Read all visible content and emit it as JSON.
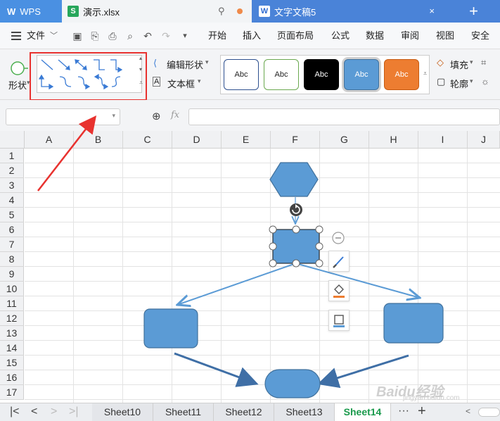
{
  "titlebar": {
    "app_tab": "WPS",
    "file_tab": "演示.xlsx",
    "doc_tab": "文字文稿5",
    "new_tab": "+",
    "close": "×"
  },
  "menubar": {
    "file_menu": "文件",
    "tabs": [
      "开始",
      "插入",
      "页面布局",
      "公式",
      "数据",
      "审阅",
      "视图",
      "安全"
    ]
  },
  "ribbon": {
    "shape_label": "形状",
    "edit_shape": "编辑形状",
    "text_box": "文本框",
    "styles": [
      "Abc",
      "Abc",
      "Abc",
      "Abc",
      "Abc"
    ],
    "fill": "填充",
    "outline": "轮廓"
  },
  "formulabar": {
    "fx": "fx",
    "name_value": "",
    "formula_value": ""
  },
  "grid": {
    "columns": [
      "A",
      "B",
      "C",
      "D",
      "E",
      "F",
      "G",
      "H",
      "I",
      "J"
    ],
    "rows": [
      "1",
      "2",
      "3",
      "4",
      "5",
      "6",
      "7",
      "8",
      "9",
      "10",
      "11",
      "12",
      "13",
      "14",
      "15",
      "16",
      "17"
    ]
  },
  "sheets": {
    "tabs": [
      "Sheet10",
      "Sheet11",
      "Sheet12",
      "Sheet13",
      "Sheet14"
    ],
    "active": "Sheet14",
    "more": "···",
    "add": "+"
  },
  "colors": {
    "shape_fill": "#5b9bd5",
    "shape_stroke": "#41719c",
    "highlight": "#e8322f",
    "active_sheet": "#1a9a4c"
  },
  "watermark": {
    "brand": "Baidu经验",
    "url": "jingyan.baidu.com"
  }
}
